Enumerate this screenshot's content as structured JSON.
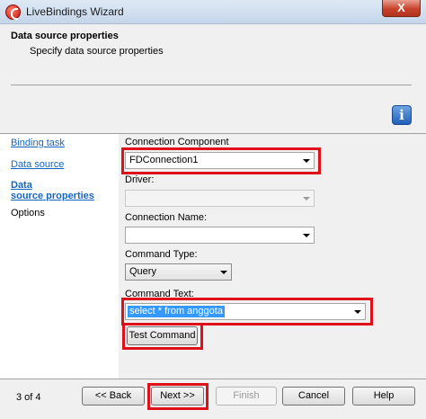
{
  "window": {
    "title": "LiveBindings Wizard",
    "close_label": "X"
  },
  "header": {
    "title": "Data source properties",
    "subtitle": "Specify data source properties",
    "info_icon_glyph": "i"
  },
  "nav": {
    "items": [
      {
        "label": "Binding task"
      },
      {
        "label": "Data source"
      },
      {
        "label_line1": "Data",
        "label_line2": "source properties"
      },
      {
        "label": "Options"
      }
    ]
  },
  "form": {
    "connection_component": {
      "label": "Connection Component",
      "value": "FDConnection1"
    },
    "driver": {
      "label": "Driver:",
      "value": ""
    },
    "connection_name": {
      "label": "Connection Name:",
      "value": ""
    },
    "command_type": {
      "label": "Command Type:",
      "value": "Query"
    },
    "command_text": {
      "label": "Command Text:",
      "value": "select * from anggota"
    },
    "test_command_label": "Test Command"
  },
  "footer": {
    "page_counter": "3 of 4",
    "back_label": "<< Back",
    "next_label": "Next >>",
    "finish_label": "Finish",
    "cancel_label": "Cancel",
    "help_label": "Help"
  },
  "colors": {
    "highlight": "#e0101a",
    "link": "#1565c0",
    "selection": "#3399ff"
  }
}
